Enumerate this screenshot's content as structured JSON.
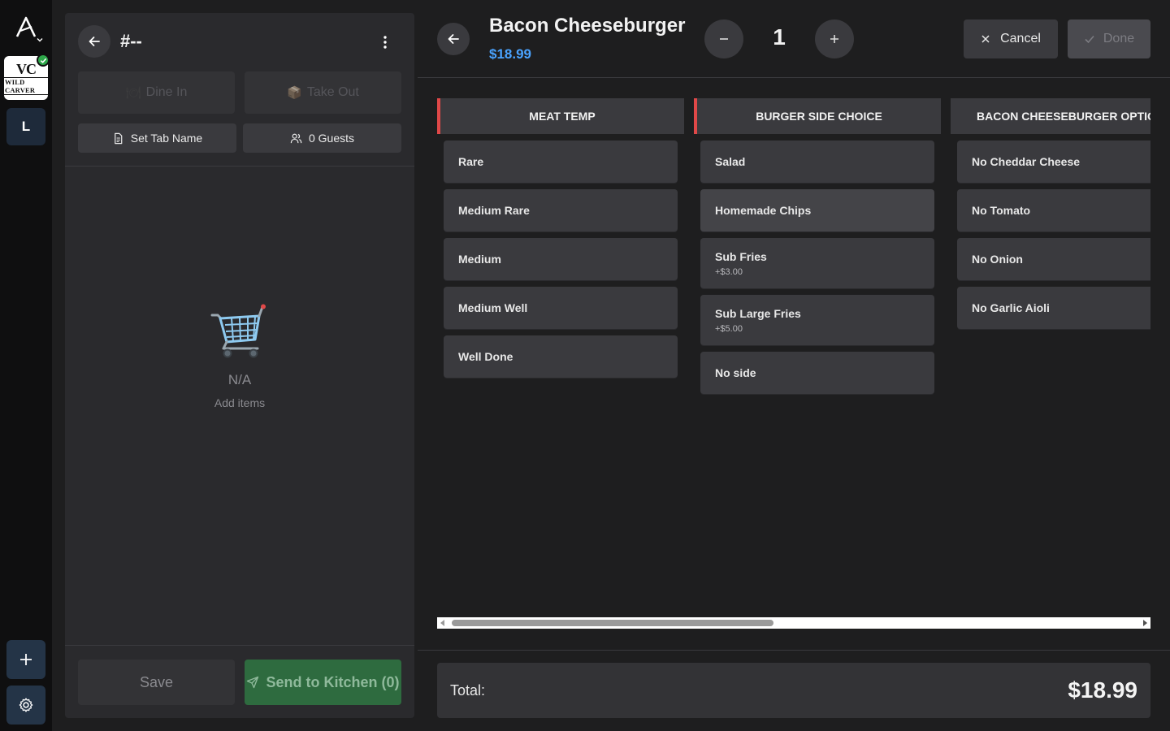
{
  "rail": {
    "brand": {
      "mark": "VC",
      "name": "WILD CARVER"
    },
    "user_initial": "L",
    "icons": {
      "logo": "app-logo-icon",
      "add": "plus-icon",
      "settings": "gear-icon",
      "verified": "check-badge-icon"
    }
  },
  "order": {
    "title": "#--",
    "order_types": [
      {
        "label": "Dine In",
        "icon": "plate-icon",
        "glyph": "🍽"
      },
      {
        "label": "Take Out",
        "icon": "package-icon",
        "glyph": "📦"
      }
    ],
    "set_tab_label": "Set Tab Name",
    "guests_label": "0 Guests",
    "empty": {
      "title": "N/A",
      "hint": "Add items"
    },
    "save_label": "Save",
    "send_label": "Send to Kitchen (0)"
  },
  "item": {
    "name": "Bacon Cheeseburger",
    "price": "$18.99",
    "quantity": "1",
    "cancel_label": "Cancel",
    "done_label": "Done"
  },
  "modifier_groups": [
    {
      "title": "MEAT TEMP",
      "required": true,
      "options": [
        {
          "label": "Rare",
          "price": ""
        },
        {
          "label": "Medium Rare",
          "price": ""
        },
        {
          "label": "Medium",
          "price": ""
        },
        {
          "label": "Medium Well",
          "price": ""
        },
        {
          "label": "Well Done",
          "price": ""
        }
      ]
    },
    {
      "title": "BURGER SIDE CHOICE",
      "required": true,
      "options": [
        {
          "label": "Salad",
          "price": ""
        },
        {
          "label": "Homemade Chips",
          "price": "",
          "highlighted": true
        },
        {
          "label": "Sub Fries",
          "price": "+$3.00"
        },
        {
          "label": "Sub Large Fries",
          "price": "+$5.00"
        },
        {
          "label": "No side",
          "price": ""
        }
      ]
    },
    {
      "title": "BACON CHEESEBURGER OPTIONS",
      "required": false,
      "options": [
        {
          "label": "No Cheddar Cheese",
          "price": ""
        },
        {
          "label": "No Tomato",
          "price": ""
        },
        {
          "label": "No Onion",
          "price": ""
        },
        {
          "label": "No Garlic Aioli",
          "price": ""
        }
      ]
    }
  ],
  "total": {
    "label": "Total:",
    "value": "$18.99"
  },
  "colors": {
    "accent_blue": "#4aa3ff",
    "required_marker": "#e04848",
    "send_green": "#2e6b3f",
    "verified_green": "#2ea84a"
  }
}
